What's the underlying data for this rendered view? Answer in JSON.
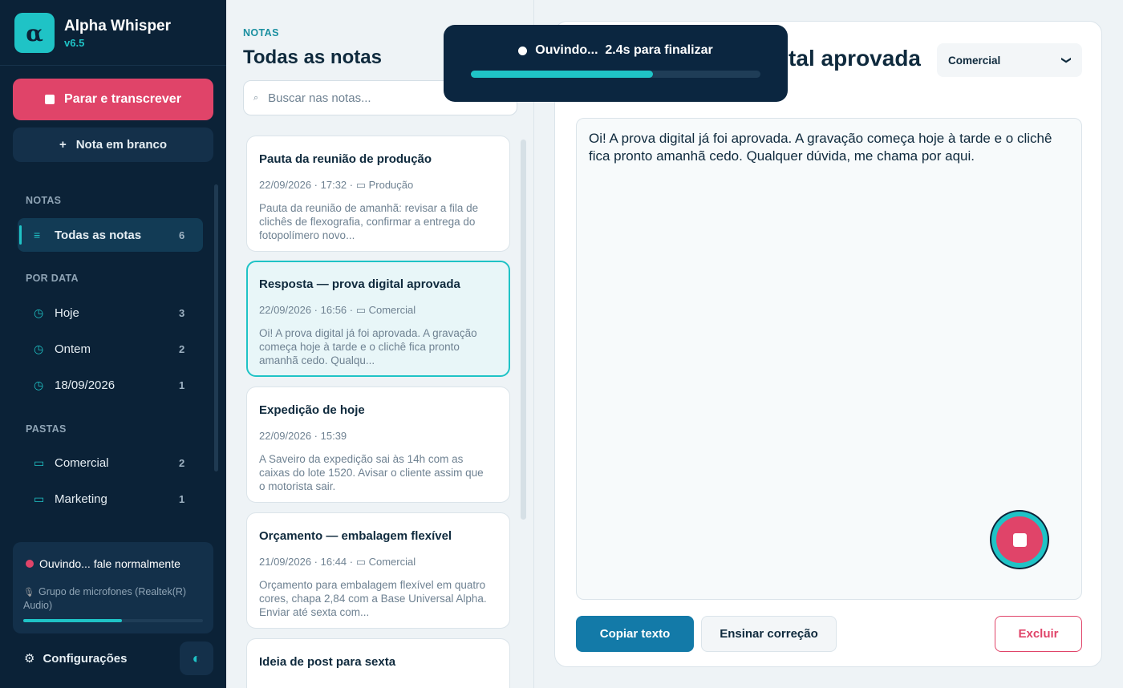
{
  "app": {
    "name": "Alpha Whisper",
    "version": "v6.5",
    "logo_glyph": "α"
  },
  "sidebar": {
    "stop_label": "Parar e transcrever",
    "blank_note_label": "Nota em branco",
    "blank_note_icon": "+",
    "section_notes": "NOTAS",
    "section_by_date": "POR DATA",
    "section_folders": "PASTAS",
    "all_notes": {
      "label": "Todas as notas",
      "count": "6",
      "icon": "≡"
    },
    "dates": [
      {
        "label": "Hoje",
        "count": "3",
        "icon": "◷"
      },
      {
        "label": "Ontem",
        "count": "2",
        "icon": "◷"
      },
      {
        "label": "18/09/2026",
        "count": "1",
        "icon": "◷"
      }
    ],
    "folders": [
      {
        "label": "Comercial",
        "count": "2",
        "icon": "▭"
      },
      {
        "label": "Marketing",
        "count": "1",
        "icon": "▭"
      }
    ],
    "status_text": "Ouvindo... fale normalmente",
    "mic_icon": "🎙",
    "mic_name": "Grupo de microfones (Realtek(R) Audio)",
    "mic_level": 0.55,
    "settings_label": "Configurações",
    "settings_icon": "⚙",
    "theme_icon": "◐"
  },
  "list": {
    "eyebrow": "NOTAS",
    "title": "Todas as notas",
    "search_placeholder": "Buscar nas notas...",
    "search_icon": "⌕",
    "notes": [
      {
        "title": "Pauta da reunião de produção",
        "meta": "22/09/2026 · 17:32  ·  ▭ Produção",
        "excerpt": "Pauta da reunião de amanhã: revisar a fila de clichês de flexografia, confirmar a entrega do fotopolímero novo..."
      },
      {
        "title": "Resposta — prova digital aprovada",
        "meta": "22/09/2026 · 16:56  ·  ▭ Comercial",
        "excerpt": "Oi! A prova digital já foi aprovada. A gravação começa hoje à tarde e o clichê fica pronto amanhã cedo. Qualqu..."
      },
      {
        "title": "Expedição de hoje",
        "meta": "22/09/2026 · 15:39",
        "excerpt": "A Saveiro da expedição sai às 14h com as caixas do lote 1520. Avisar o cliente assim que o motorista sair."
      },
      {
        "title": "Orçamento — embalagem flexível",
        "meta": "21/09/2026 · 16:44  ·  ▭ Comercial",
        "excerpt": "Orçamento para embalagem flexível em quatro cores, chapa 2,84 com a Base Universal Alpha. Enviar até sexta com..."
      },
      {
        "title": "Ideia de post para sexta",
        "meta": "",
        "excerpt": ""
      }
    ]
  },
  "editor": {
    "title": "Resposta — prova digital aprovada",
    "folder": "Comercial",
    "folder_chevron": "❯",
    "body": "Oi! A prova digital já foi aprovada. A gravação começa hoje à tarde e o clichê fica pronto amanhã cedo. Qualquer dúvida, me chama por aqui.",
    "copy_label": "Copiar texto",
    "teach_label": "Ensinar correção",
    "delete_label": "Excluir"
  },
  "toast": {
    "text": "Ouvindo...  2.4s para finalizar",
    "progress": 0.63
  },
  "colors": {
    "accent": "#1fc3c6",
    "danger": "#e04469",
    "primary": "#137aa8",
    "sidebar_bg": "#0b2237"
  }
}
